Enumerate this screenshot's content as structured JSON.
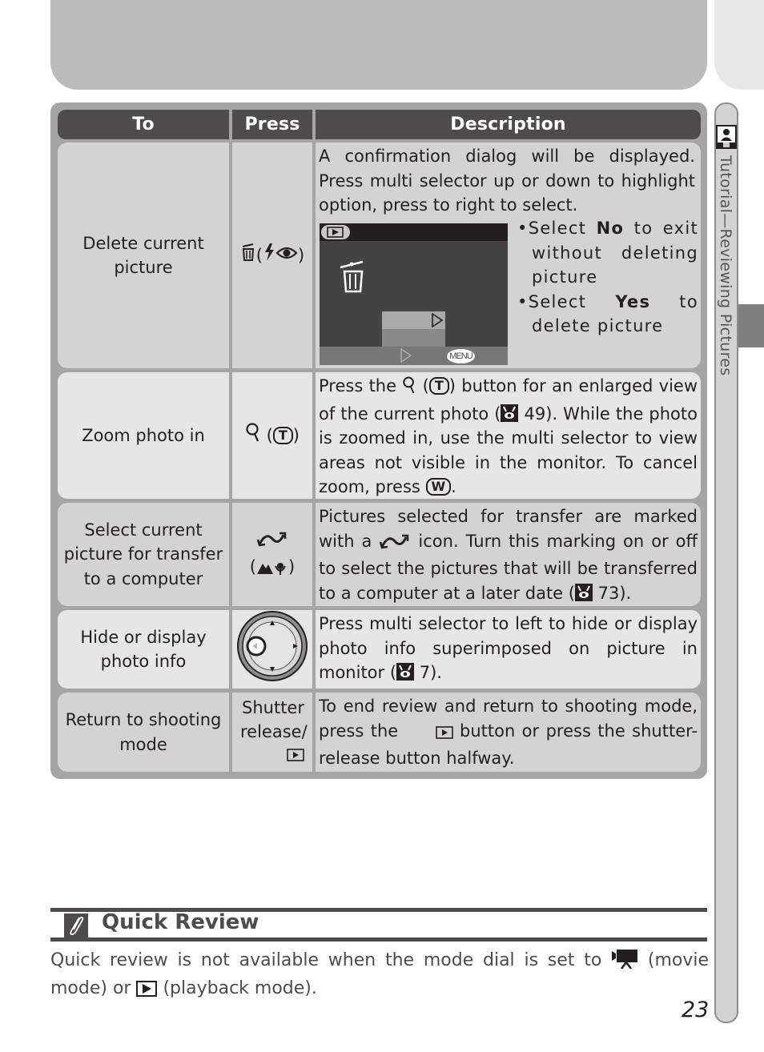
{
  "page": {
    "number": "23",
    "side_tab_label": "Tutorial—Reviewing Pictures"
  },
  "table": {
    "headers": {
      "to": "To",
      "press": "Press",
      "description": "Description"
    },
    "rows": [
      {
        "to": "Delete current picture",
        "press_icons": [
          "trash-icon",
          "(",
          "flash-icon",
          "red-eye-icon",
          ")"
        ],
        "description": "A confirmation dialog will be displayed.  Press multi selector up or down to highlight option, press to right to select.",
        "bullets": [
          {
            "pre": "Select ",
            "bold": "No",
            "post": " to exit without deleting picture"
          },
          {
            "pre": "Select ",
            "bold": "Yes",
            "post": " to delete picture"
          }
        ],
        "screen": {
          "menu_label": "MENU"
        }
      },
      {
        "to": "Zoom photo in",
        "press_key": "T",
        "description_parts": {
          "a": "Press the ",
          "b": " button for an enlarged view of the current photo (",
          "ref1": " 49).  While the photo is zoomed in, use the multi selector to view areas not visible in the monitor.  To cancel zoom, press ",
          "key_w": "W",
          "end": "."
        }
      },
      {
        "to": "Select current picture for transfer to a computer",
        "description_parts": {
          "a": "Pictures selected for transfer are marked with a ",
          "b": " icon.  Turn this marking on or off to select the pictures that will be transferred to a computer at a later date (",
          "ref": " 73)."
        }
      },
      {
        "to": "Hide or display photo info",
        "description_parts": {
          "a": "Press multi selector to left to hide or display photo info superimposed on picture in monitor (",
          "ref": " 7)."
        }
      },
      {
        "to": "Return to shooting mode",
        "press_text": "Shutter release/",
        "description_parts": {
          "a": "To end review and return to shooting mode, press the ",
          "b": " button or press the shutter-release button halfway."
        }
      }
    ]
  },
  "note": {
    "title": "Quick Review",
    "body_a": "Quick review is not available when the mode dial is set to ",
    "body_b": " (movie mode) or ",
    "body_c": " (playback mode)."
  }
}
